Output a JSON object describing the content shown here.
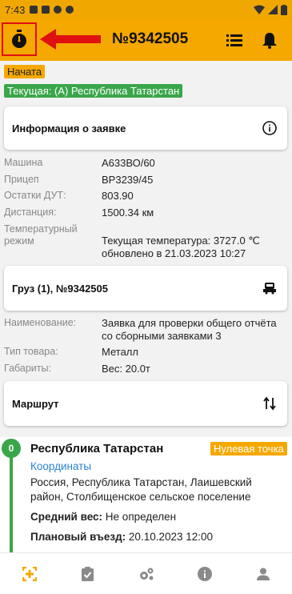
{
  "statusbar": {
    "time": "7:43"
  },
  "appbar": {
    "title": "№9342505"
  },
  "badges": {
    "status": "Начата",
    "current": "Текущая: (А) Республика Татарстан"
  },
  "order_info": {
    "title": "Информация о заявке",
    "rows": [
      {
        "label": "Машина",
        "value": "А633ВО/60"
      },
      {
        "label": "Прицеп",
        "value": "ВР3239/45"
      },
      {
        "label": "Остатки ДУТ:",
        "value": "803.90"
      },
      {
        "label": "Дистанция:",
        "value": "1500.34 км"
      },
      {
        "label": "Температурный режим",
        "value": "Текущая температура: 3727.0 ℃ обновлено в 21.03.2023 10:27"
      }
    ]
  },
  "cargo": {
    "title": "Груз (1), №9342505",
    "rows": [
      {
        "label": "Наименование:",
        "value": "Заявка для проверки общего отчёта со сборными заявками 3"
      },
      {
        "label": "Тип товара:",
        "value": "Металл"
      },
      {
        "label": "Габариты:",
        "value": "Вес: 20.0т"
      }
    ]
  },
  "route": {
    "title": "Маршрут",
    "point": {
      "index": "0",
      "name": "Республика Татарстан",
      "tag": "Нулевая точка",
      "coords_link": "Координаты",
      "address": "Россия, Республика Татарстан, Лаишевский район, Столбищенское сельское поселение",
      "avg_weight_label": "Средний вес:",
      "avg_weight_value": "Не определен",
      "plan_label": "Плановый въезд:",
      "plan_value": "20.10.2023 12:00"
    }
  },
  "colors": {
    "accent": "#f5a800",
    "green": "#3aa64a",
    "link": "#2b83d6",
    "arrow": "#e01010"
  },
  "icons": {
    "appbar": [
      "stopwatch-icon",
      "list-icon",
      "bell-icon"
    ],
    "cards": [
      "info-icon",
      "truck-icon",
      "swap-vertical-icon"
    ],
    "nav": [
      "plus-box-icon",
      "clipboard-check-icon",
      "gears-icon",
      "info-circle-icon",
      "person-icon"
    ]
  }
}
